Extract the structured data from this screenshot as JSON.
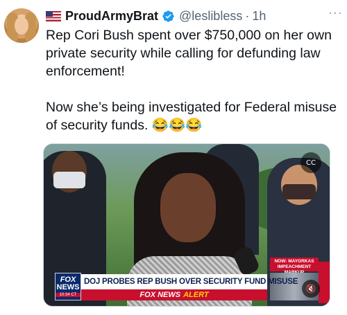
{
  "tweet": {
    "display_name": "ProudArmyBrat",
    "handle": "@leslibless",
    "separator": "·",
    "time": "1h",
    "more_label": "···",
    "text": "Rep Cori Bush spent over $750,000 on her own private security while calling for defunding law enforcement!\n\nNow she’s being investigated for Federal misuse of security funds. 😂😂😂"
  },
  "media": {
    "cc_label": "CC",
    "logo_line1": "FOX",
    "logo_line2": "NEWS",
    "logo_time": "10:34 CT",
    "chyron": "DOJ PROBES REP BUSH OVER SECURITY FUND MISUSE",
    "network_label": "FOX NEWS",
    "alert_label": "ALERT",
    "side_box": "NOW: MAYORKAS\nIMPEACHMENT MARKUP",
    "mute_label": "🔇"
  },
  "colors": {
    "verified_blue": "#1d9bf0",
    "fox_red": "#c8102e",
    "fox_navy": "#0b2a6b"
  }
}
